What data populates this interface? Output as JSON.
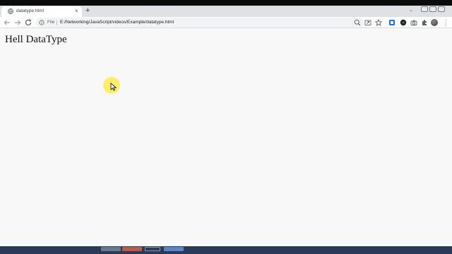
{
  "browser": {
    "tab": {
      "title": "datatype.html",
      "close_label": "×"
    },
    "new_tab_label": "+",
    "tab_menu_label": "⌄",
    "address_bar": {
      "scheme_label": "File",
      "url": "E:/Networking/JavaScript/videos/Example/datatype.html"
    },
    "menu_label": "⋮"
  },
  "page": {
    "heading": "Hell DataType"
  },
  "colors": {
    "tab_strip": "#dfe1e5",
    "page_background": "#f7f8f7",
    "cursor_highlight": "#ffec50",
    "taskbar": "#2b3a55"
  },
  "icons": [
    "globe-icon",
    "back-arrow-icon",
    "forward-arrow-icon",
    "reload-icon",
    "info-icon",
    "zoom-icon",
    "share-icon",
    "star-icon",
    "extension-icon",
    "puzzle-icon",
    "profile-avatar",
    "more-menu-icon",
    "cursor-icon"
  ]
}
